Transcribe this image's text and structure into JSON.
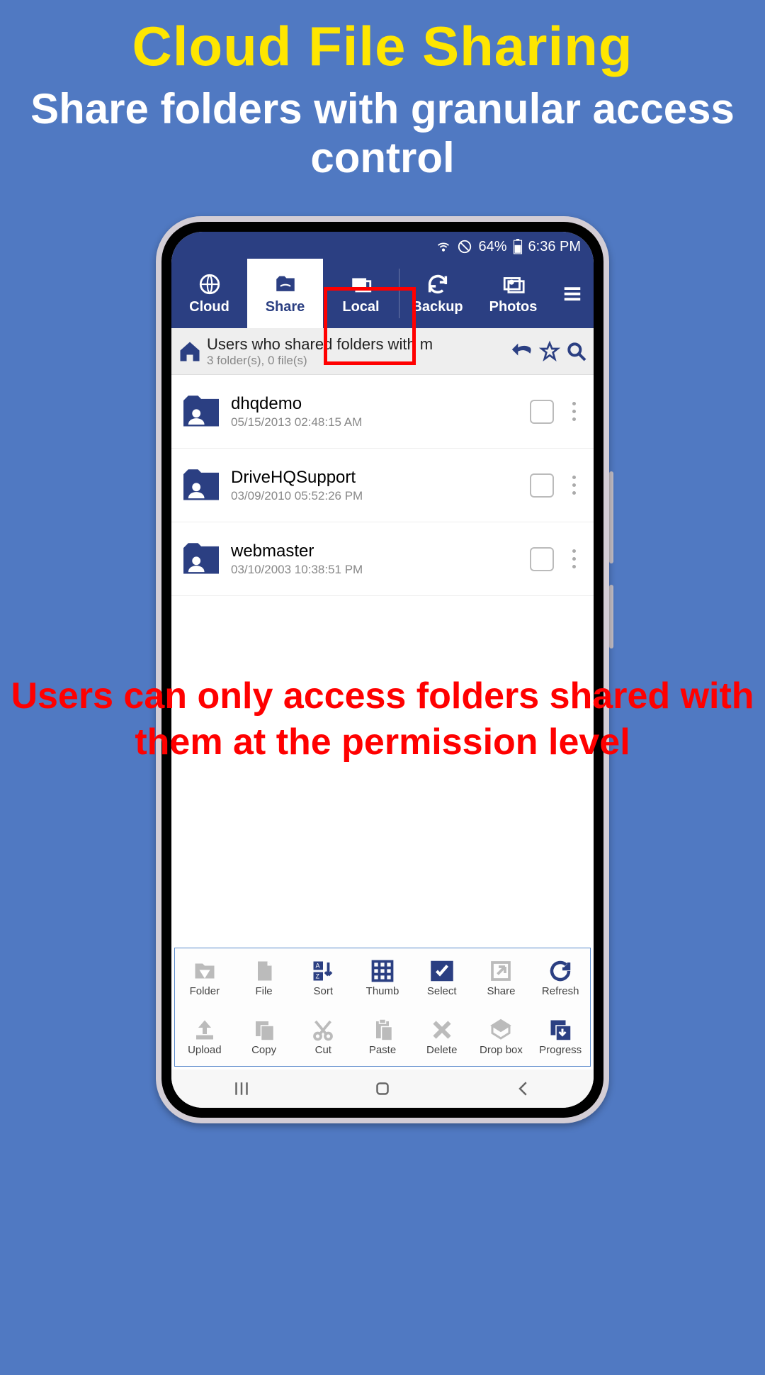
{
  "promo": {
    "title": "Cloud File Sharing",
    "subtitle": "Share folders with granular access control"
  },
  "status": {
    "battery": "64%",
    "time": "6:36 PM"
  },
  "tabs": {
    "cloud": "Cloud",
    "share": "Share",
    "local": "Local",
    "backup": "Backup",
    "photos": "Photos"
  },
  "breadcrumb": {
    "title": "Users who shared folders with m",
    "sub": "3 folder(s), 0 file(s)"
  },
  "items": [
    {
      "name": "dhqdemo",
      "date": "05/15/2013 02:48:15 AM"
    },
    {
      "name": "DriveHQSupport",
      "date": "03/09/2010 05:52:26 PM"
    },
    {
      "name": "webmaster",
      "date": "03/10/2003 10:38:51 PM"
    }
  ],
  "overlay": "Users can only access folders shared with them at the permission level",
  "toolbar": {
    "folder": "Folder",
    "file": "File",
    "sort": "Sort",
    "thumb": "Thumb",
    "select": "Select",
    "share": "Share",
    "refresh": "Refresh",
    "upload": "Upload",
    "copy": "Copy",
    "cut": "Cut",
    "paste": "Paste",
    "delete": "Delete",
    "dropbox": "Drop box",
    "progress": "Progress"
  }
}
